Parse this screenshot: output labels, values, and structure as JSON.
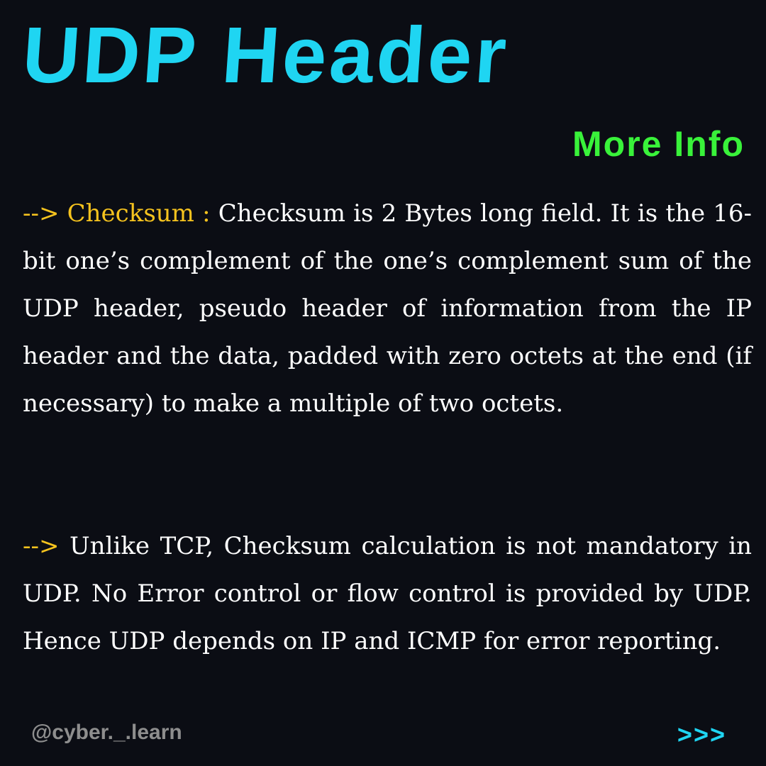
{
  "title": "UDP Header",
  "more_info": "More Info",
  "paragraph1": {
    "arrow": "-->",
    "label": "Checksum :",
    "text": "Checksum is 2 Bytes long field. It is the 16-bit one’s complement of the one’s complement sum of the UDP header, pseudo header of information from the IP header and the data, padded with zero octets at the end (if necessary) to make a multiple of two octets."
  },
  "paragraph2": {
    "arrow": "-->",
    "text": "Unlike TCP, Checksum calculation is not mandatory in UDP. No Error control or flow control is provided by UDP. Hence UDP depends on IP and ICMP for error reporting."
  },
  "footer": {
    "handle": "@cyber._.learn",
    "next": ">>>"
  },
  "colors": {
    "background": "#0b0d14",
    "title": "#1fd5f2",
    "more_info": "#39f23a",
    "accent": "#f6c31e",
    "body_text": "#ffffff",
    "handle": "#8e8e8e"
  }
}
